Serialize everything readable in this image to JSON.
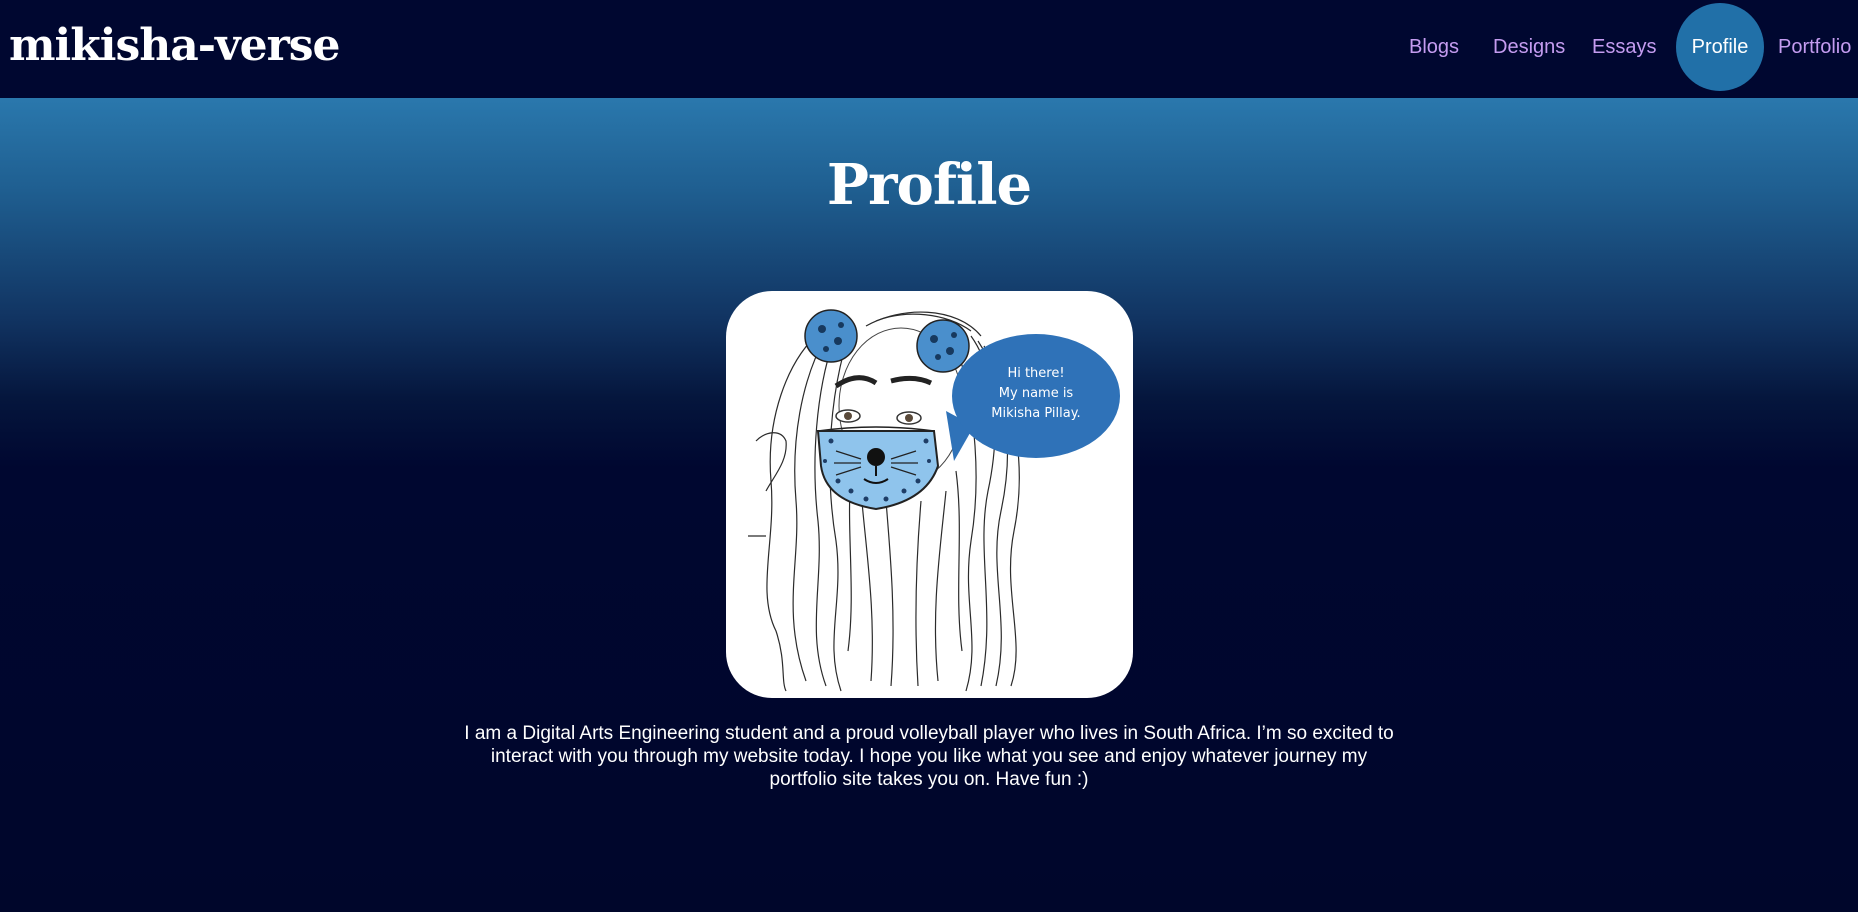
{
  "header": {
    "brand": "mikisha-verse",
    "nav": [
      {
        "label": "Blogs"
      },
      {
        "label": "Designs"
      },
      {
        "label": "Essays"
      },
      {
        "label": "Profile",
        "active": true
      },
      {
        "label": "Portfolio"
      }
    ]
  },
  "main": {
    "title": "Profile",
    "illustration": {
      "speech_bubble": [
        "Hi there!",
        "My name is",
        "Mikisha Pillay."
      ]
    },
    "bio": "I am a Digital Arts Engineering student and a proud volleyball player who lives in South Africa. I’m so excited to interact with you through my website today. I hope you like what you see and enjoy whatever journey my portfolio site takes you on. Have fun :)"
  },
  "colors": {
    "topbar": "#000730",
    "nav_link": "#c49cf0",
    "nav_active_bg": "#2170a8",
    "hero_top": "#2a78ad",
    "page_bg": "#00062b"
  }
}
